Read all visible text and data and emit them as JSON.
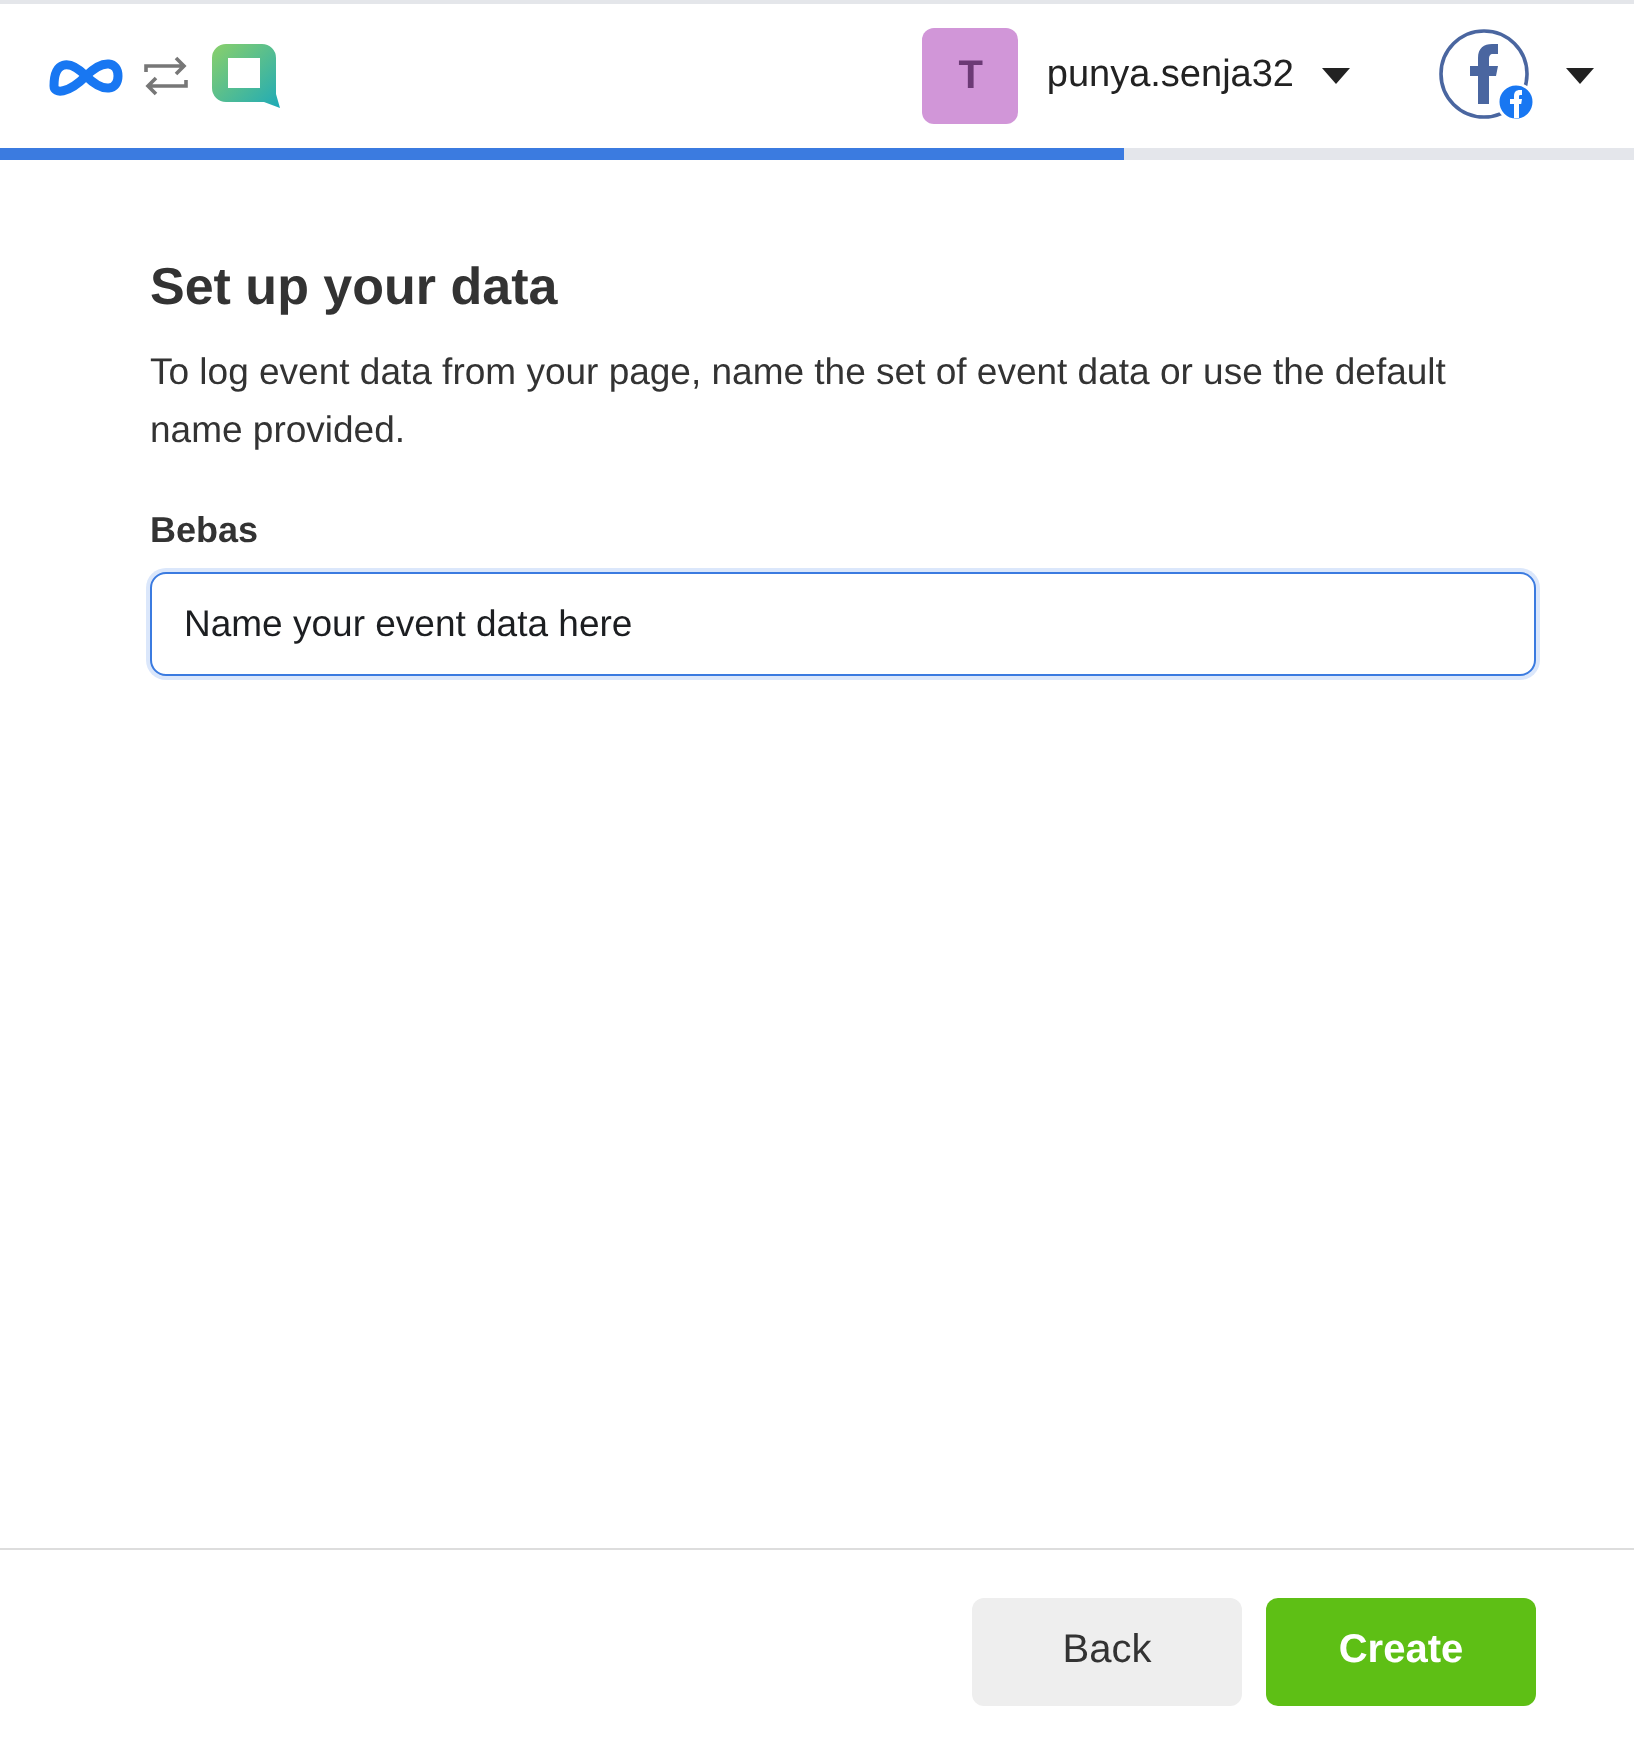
{
  "header": {
    "account": {
      "initial": "T",
      "name": "punya.senja32"
    }
  },
  "progress": {
    "level": 0.688
  },
  "form": {
    "title": "Set up your data",
    "description": "To log event data from your page, name the set of event data or use the default name provided.",
    "field_label": "Bebas",
    "field_value": "Name your event data here"
  },
  "buttons": [
    {
      "kind": "secondary",
      "label": "Back"
    },
    {
      "kind": "primary",
      "label": "Create"
    }
  ]
}
